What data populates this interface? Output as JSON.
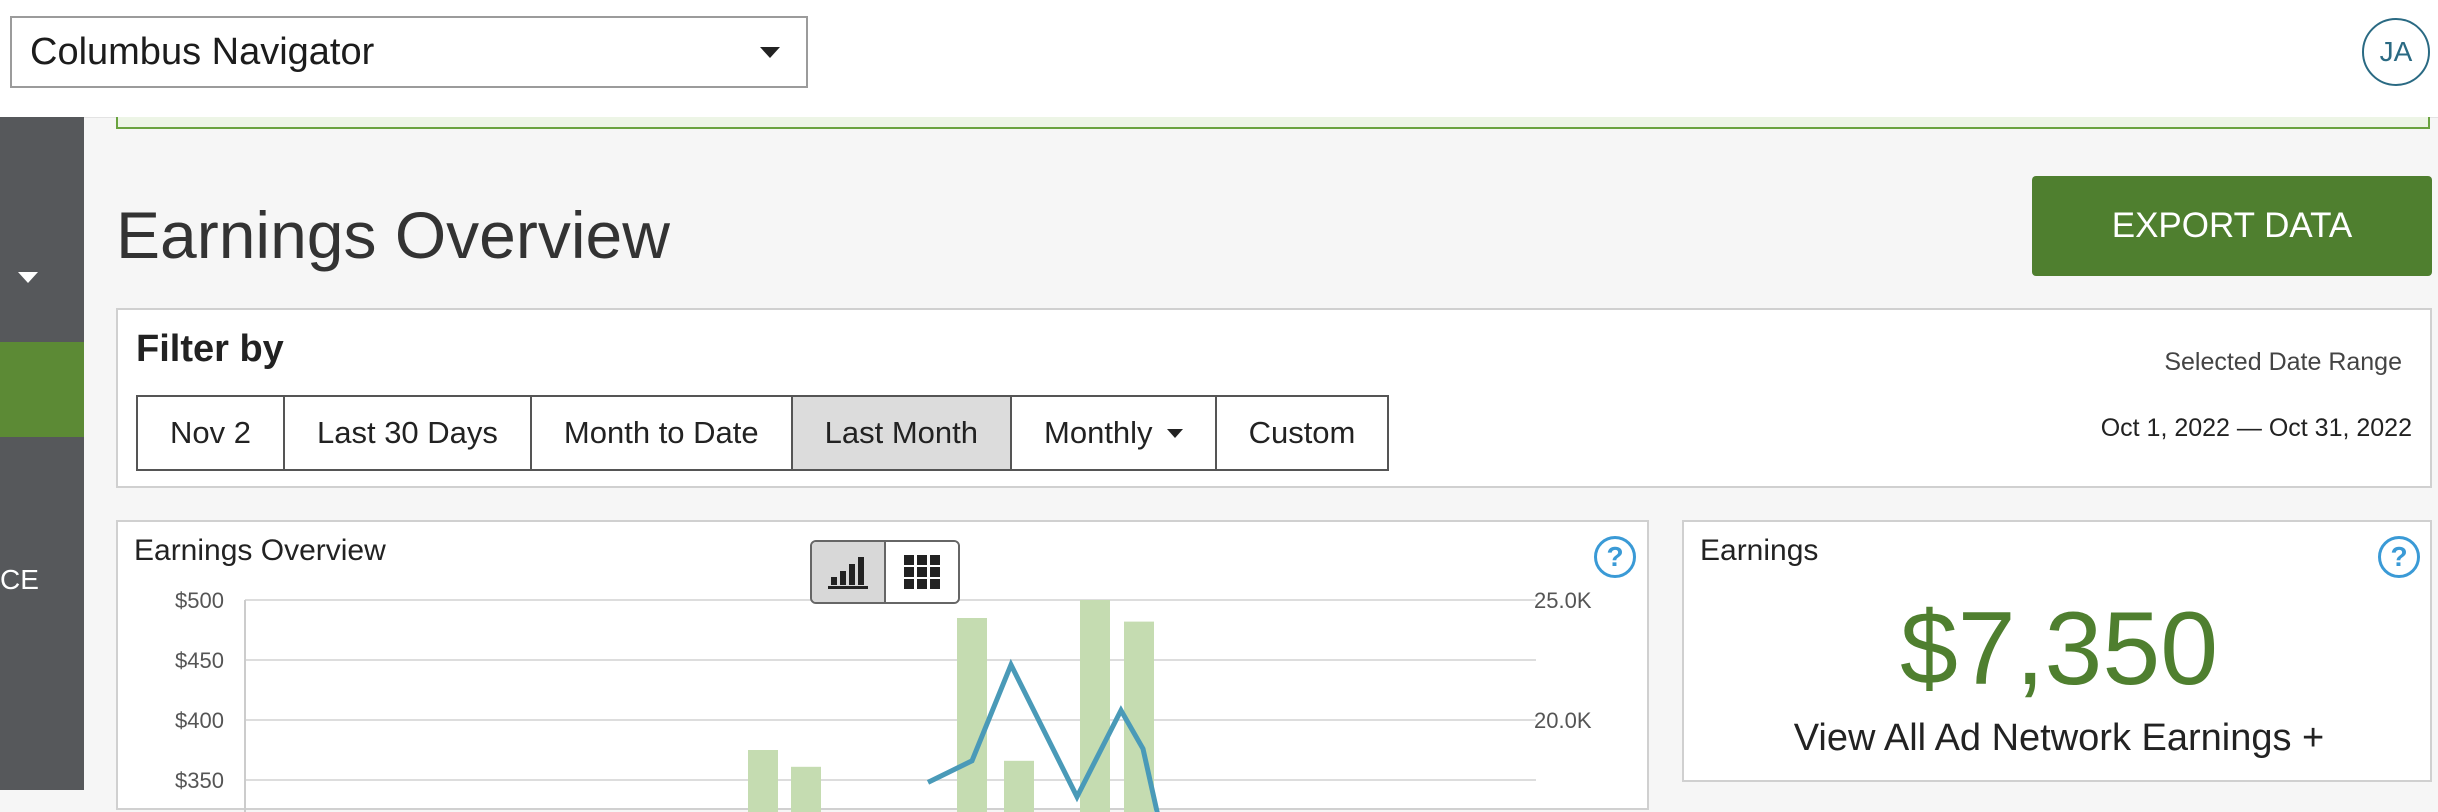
{
  "header": {
    "site_selector": {
      "value": "Columbus Navigator"
    },
    "avatar_initials": "JA"
  },
  "sidebar": {
    "partial_label": "CE"
  },
  "page": {
    "title": "Earnings Overview",
    "export_label": "EXPORT DATA"
  },
  "filter": {
    "title": "Filter by",
    "options": [
      "Nov 2",
      "Last 30 Days",
      "Month to Date",
      "Last Month",
      "Monthly",
      "Custom"
    ],
    "selected": "Last Month",
    "range_label": "Selected Date Range",
    "range_value": "Oct 1, 2022 — Oct 31, 2022"
  },
  "earnings_card": {
    "title": "Earnings",
    "value": "$7,350",
    "link": "View All Ad Network Earnings +"
  },
  "colors": {
    "accent_green": "#4f7f2f",
    "bar_green": "#c5dcb1",
    "line_blue": "#4a9ab8",
    "help_blue": "#3a9ad6"
  },
  "chart_data": {
    "type": "bar",
    "title": "Earnings Overview",
    "y_left_ticks": [
      "$500",
      "$450",
      "$400",
      "$350"
    ],
    "y_right_ticks": [
      "25.0K",
      "20.0K"
    ],
    "ylim_left": [
      350,
      500
    ],
    "ylim_right": [
      17500,
      25000
    ],
    "grid": true,
    "series": [
      {
        "values": [
          375,
          361,
          485,
          366,
          500,
          482
        ]
      },
      {
        "values": [
          17400,
          18300,
          22300,
          16800,
          20400,
          18800,
          16000
        ]
      }
    ],
    "view_toggle": [
      "bar-chart-icon",
      "grid-icon"
    ]
  }
}
